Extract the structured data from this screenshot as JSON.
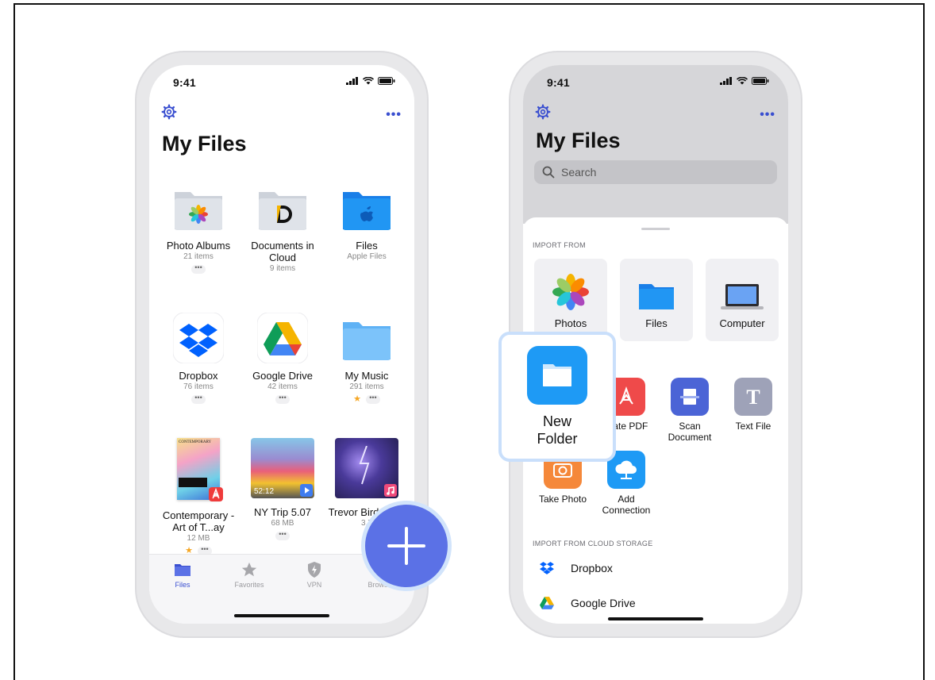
{
  "left_phone": {
    "status": {
      "time": "9:41"
    },
    "title": "My Files",
    "items": [
      {
        "name": "Photo Albums",
        "sub": "21 items",
        "dots": "•••"
      },
      {
        "name": "Documents in Cloud",
        "sub": "9 items"
      },
      {
        "name": "Files",
        "sub": "Apple Files"
      },
      {
        "name": "Dropbox",
        "sub": "76 items",
        "dots": "•••"
      },
      {
        "name": "Google Drive",
        "sub": "42 items",
        "dots": "•••"
      },
      {
        "name": "My Music",
        "sub": "291 items",
        "dots": "•••",
        "starred": true
      },
      {
        "name": "Contemporary - Art of T...ay",
        "sub": "12 MB",
        "dots": "•••",
        "starred": true,
        "thumb_text": "CONTEMPORARY"
      },
      {
        "name": "NY Trip 5.07",
        "sub": "68 MB",
        "dots": "•••",
        "duration": "52:12"
      },
      {
        "name": "Trevor Bird Thun",
        "sub": "3,7"
      }
    ],
    "tabs": [
      {
        "label": "Files",
        "active": true
      },
      {
        "label": "Favorites"
      },
      {
        "label": "VPN"
      },
      {
        "label": "Browser"
      }
    ],
    "more_label": "•••"
  },
  "right_phone": {
    "status": {
      "time": "9:41"
    },
    "title": "My Files",
    "search_placeholder": "Search",
    "more_label": "•••",
    "import_from_header": "IMPORT FROM",
    "import_tiles": [
      {
        "label": "Photos"
      },
      {
        "label": "Files"
      },
      {
        "label": "Computer"
      }
    ],
    "actions": [
      {
        "label": "reate PDF"
      },
      {
        "label": "Scan Document"
      },
      {
        "label": "Text File"
      },
      {
        "label": "Take Photo"
      },
      {
        "label": "Add Connection"
      }
    ],
    "cloud_header": "IMPORT FROM CLOUD STORAGE",
    "cloud_items": [
      {
        "label": "Dropbox"
      },
      {
        "label": "Google Drive"
      }
    ]
  },
  "new_folder_card": {
    "label_line1": "New",
    "label_line2": "Folder"
  },
  "colors": {
    "accent": "#3a4fd0",
    "fab": "#5b71e6",
    "folder_blue": "#1e9af5"
  }
}
